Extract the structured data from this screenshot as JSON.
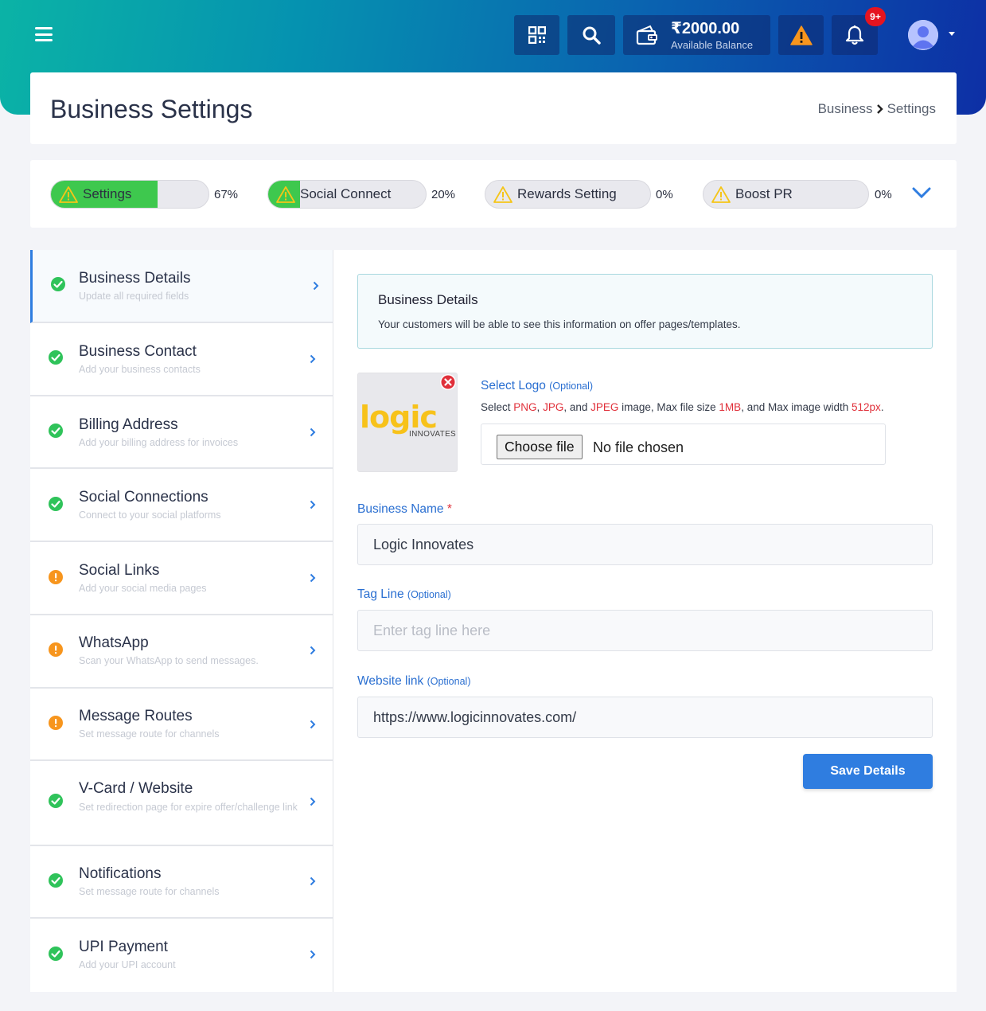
{
  "topbar": {
    "wallet_amount": "₹2000.00",
    "wallet_label": "Available Balance",
    "notification_count": "9+",
    "icons": [
      "menu-icon",
      "qr-code-icon",
      "search-icon",
      "wallet-icon",
      "warning-icon",
      "bell-icon",
      "avatar-icon",
      "caret-down-icon"
    ]
  },
  "header": {
    "title": "Business Settings",
    "breadcrumb": [
      "Business",
      "Settings"
    ]
  },
  "progress": {
    "items": [
      {
        "label": "Settings",
        "percent_text": "67%",
        "fill": 0.67,
        "status": "warning"
      },
      {
        "label": "Social Connect",
        "percent_text": "20%",
        "fill": 0.2,
        "status": "warning"
      },
      {
        "label": "Rewards Setting",
        "percent_text": "0%",
        "fill": 0.0,
        "status": "warning"
      },
      {
        "label": "Boost PR",
        "percent_text": "0%",
        "fill": 0.0,
        "status": "warning"
      }
    ],
    "fill_color": "#3ec84e"
  },
  "sidebar": {
    "items": [
      {
        "title": "Business Details",
        "subtitle": "Update all required fields",
        "status": "complete",
        "active": true
      },
      {
        "title": "Business Contact",
        "subtitle": "Add your business contacts",
        "status": "complete"
      },
      {
        "title": "Billing Address",
        "subtitle": "Add your billing address for invoices",
        "status": "complete"
      },
      {
        "title": "Social Connections",
        "subtitle": "Connect to your social platforms",
        "status": "complete"
      },
      {
        "title": "Social Links",
        "subtitle": "Add your social media pages",
        "status": "pending"
      },
      {
        "title": "WhatsApp",
        "subtitle": "Scan your WhatsApp to send messages.",
        "status": "pending"
      },
      {
        "title": "Message Routes",
        "subtitle": "Set message route for channels",
        "status": "pending"
      },
      {
        "title": "V-Card / Website",
        "subtitle": "Set redirection page for expire offer/challenge link",
        "status": "complete"
      },
      {
        "title": "Notifications",
        "subtitle": "Set message route for channels",
        "status": "complete"
      },
      {
        "title": "UPI Payment",
        "subtitle": "Add your UPI account",
        "status": "complete"
      }
    ]
  },
  "main": {
    "info_title": "Business Details",
    "info_text": "Your customers will be able to see this information on offer pages/templates.",
    "logo": {
      "label": "Select Logo",
      "optional": "(Optional)",
      "image_text": "logic",
      "image_subtext": "INNOVATES",
      "hint_parts": [
        "Select ",
        "PNG",
        ", ",
        "JPG",
        ", and ",
        "JPEG",
        " image, Max file size ",
        "1MB",
        ", and Max image width ",
        "512px",
        "."
      ],
      "choose_file_label": "Choose file",
      "file_status": "No file chosen"
    },
    "business_name": {
      "label": "Business Name",
      "required_mark": "*",
      "value": "Logic Innovates"
    },
    "tag_line": {
      "label": "Tag Line",
      "optional": "(Optional)",
      "value": "",
      "placeholder": "Enter tag line here"
    },
    "website": {
      "label": "Website link",
      "optional": "(Optional)",
      "value": "https://www.logicinnovates.com/"
    },
    "save_label": "Save Details"
  },
  "colors": {
    "accent": "#2f7de0",
    "success": "#2fc35a",
    "warning": "#f7951d",
    "danger": "#e0303a"
  }
}
